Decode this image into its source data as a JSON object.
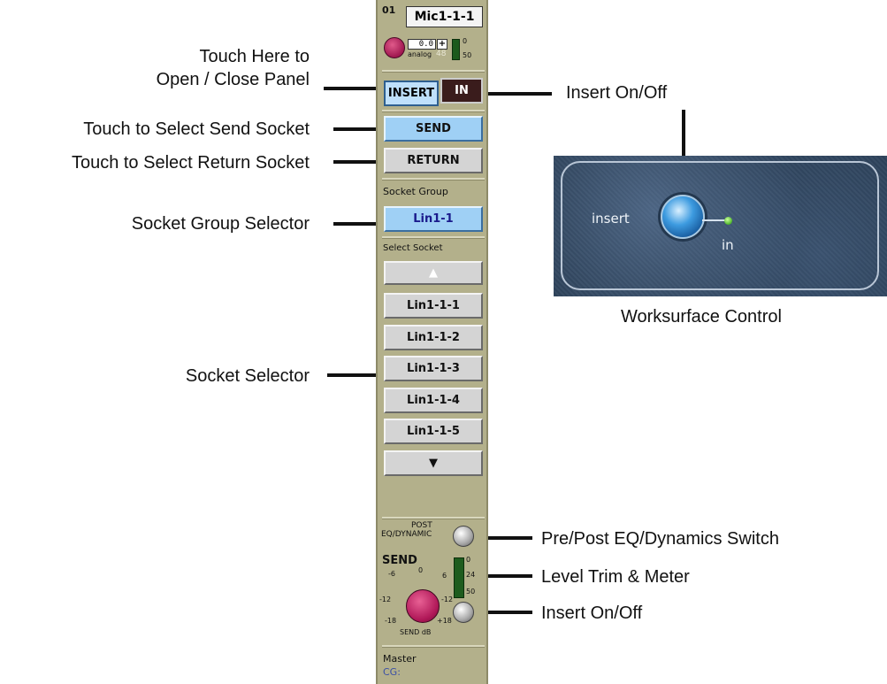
{
  "callouts": {
    "open_close_line1": "Touch Here to",
    "open_close_line2": "Open / Close Panel",
    "insert_onoff_top": "Insert On/Off",
    "select_send": "Touch to Select Send Socket",
    "select_return": "Touch to Select Return Socket",
    "socket_group_selector": "Socket Group Selector",
    "socket_selector": "Socket Selector",
    "worksurface_control": "Worksurface Control",
    "pre_post": "Pre/Post EQ/Dynamics Switch",
    "level_trim": "Level Trim & Meter",
    "insert_onoff_bottom": "Insert On/Off"
  },
  "strip": {
    "channel_number": "01",
    "channel_name": "Mic1-1-1",
    "trim_value": "0.0",
    "plus_label": "+",
    "analog_label": "analog",
    "phantom_label": "48",
    "meter_top": "0",
    "meter_bottom": "50",
    "insert_label": "INSERT",
    "in_label": "IN",
    "send_label": "SEND",
    "return_label": "RETURN",
    "socket_group_heading": "Socket Group",
    "socket_group_value": "Lin1-1",
    "select_socket_heading": "Select Socket",
    "up_arrow": "▲",
    "down_arrow": "▼",
    "sockets": [
      "Lin1-1-1",
      "Lin1-1-2",
      "Lin1-1-3",
      "Lin1-1-4",
      "Lin1-1-5"
    ],
    "post_label": "POST",
    "eq_dynamic_label": "EQ/DYNAMIC",
    "send_section_label": "SEND",
    "send_scale": {
      "m6": "-6",
      "z": "0",
      "p6": "6",
      "m12": "-12",
      "p12": "-12",
      "m18": "-18",
      "p18": "+18"
    },
    "send_db_label": "SEND dB",
    "send_meter": {
      "top": "0",
      "mid": "24",
      "bottom": "50"
    },
    "master_label": "Master",
    "cg_label": "CG:"
  },
  "worksurface": {
    "insert_label": "insert",
    "in_label": "in"
  },
  "colors": {
    "strip_bg": "#b3b08b",
    "selected_blue": "#9fd0f5",
    "knob_magenta": "#b01858"
  }
}
